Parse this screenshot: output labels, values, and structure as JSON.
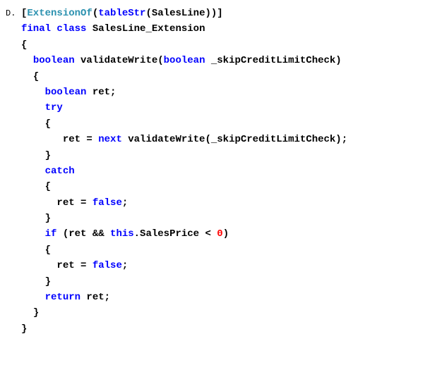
{
  "option_label": "D.",
  "code": {
    "l1_open_br": "[",
    "l1_fn": "ExtensionOf",
    "l1_open_p": "(",
    "l1_kw": "tableStr",
    "l1_open_p2": "(",
    "l1_arg": "SalesLine",
    "l1_close": "))]",
    "l2_final": "final",
    "l2_class": "class",
    "l2_name": "SalesLine_Extension",
    "l3": "{",
    "l4_bool": "boolean",
    "l4_name": "validateWrite(",
    "l4_bool2": "boolean",
    "l4_param": " _skipCreditLimitCheck)",
    "l5": "{",
    "l6_bool": "boolean",
    "l6_var": " ret;",
    "l7_try": "try",
    "l8": "{",
    "l9_ret": "ret = ",
    "l9_next": "next",
    "l9_call": " validateWrite(_skipCreditLimitCheck);",
    "l10": "}",
    "l11_catch": "catch",
    "l12": "{",
    "l13_ret": "ret = ",
    "l13_false": "false",
    "l13_semi": ";",
    "l14": "}",
    "l15_if": "if",
    "l15_open": " (ret && ",
    "l15_this": "this",
    "l15_prop": ".SalesPrice < ",
    "l15_zero": "0",
    "l15_close": ")",
    "l16": "{",
    "l17_ret": "ret = ",
    "l17_false": "false",
    "l17_semi": ";",
    "l18": "}",
    "l19_return": "return",
    "l19_var": " ret;",
    "l20": "}",
    "l21": "}"
  }
}
